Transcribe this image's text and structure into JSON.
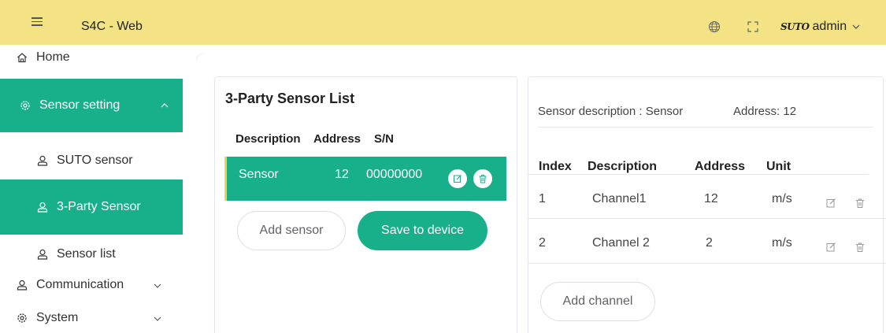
{
  "header": {
    "app_title": "S4C - Web",
    "brand": "SUTO",
    "user": "admin",
    "background": "#f4e385"
  },
  "sidebar": {
    "accent": "#17b08a",
    "items": [
      {
        "label": "Home",
        "icon": "home-icon"
      },
      {
        "label": "Sensor setting",
        "icon": "gear-icon"
      },
      {
        "label": "SUTO sensor",
        "icon": "user-icon"
      },
      {
        "label": "3-Party Sensor",
        "icon": "user-icon"
      },
      {
        "label": "Sensor list",
        "icon": "user-icon"
      },
      {
        "label": "Communication",
        "icon": "user-icon"
      },
      {
        "label": "System",
        "icon": "gear-icon"
      }
    ]
  },
  "sensor_list": {
    "title": "3-Party Sensor List",
    "columns": [
      "Description",
      "Address",
      "S/N"
    ],
    "rows": [
      {
        "description": "Sensor",
        "address": "12",
        "sn": "00000000"
      }
    ],
    "add_label": "Add sensor",
    "save_label": "Save to device"
  },
  "channels": {
    "sensor_description": "Sensor description : Sensor",
    "address": "Address: 12",
    "columns": [
      "Index",
      "Description",
      "Address",
      "Unit"
    ],
    "rows": [
      {
        "index": "1",
        "description": "Channel1",
        "address": "12",
        "unit": "m/s"
      },
      {
        "index": "2",
        "description": "Channel 2",
        "address": "2",
        "unit": "m/s"
      }
    ],
    "add_label": "Add channel"
  }
}
